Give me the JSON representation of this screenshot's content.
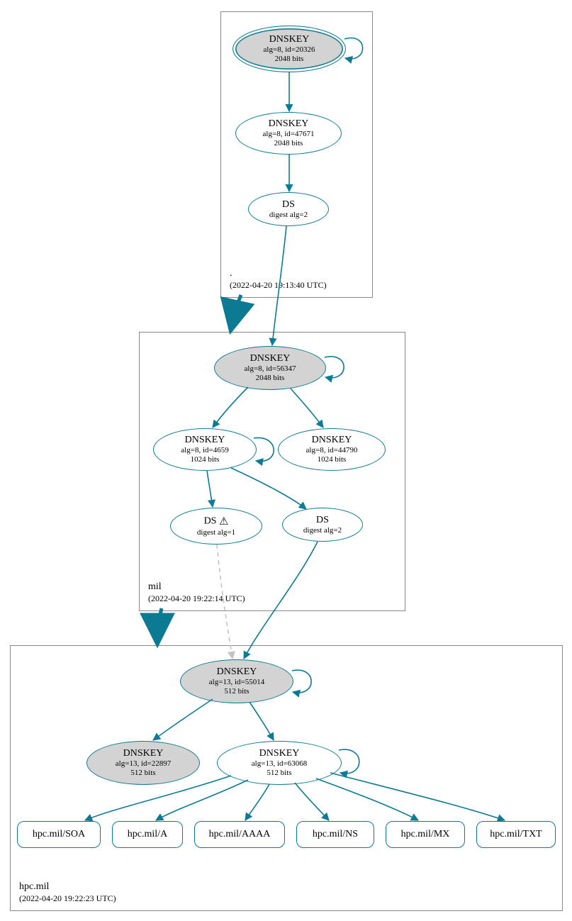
{
  "zones": {
    "root": {
      "name": ".",
      "timestamp": "(2022-04-20 19:13:40 UTC)"
    },
    "mil": {
      "name": "mil",
      "timestamp": "(2022-04-20 19:22:14 UTC)"
    },
    "hpc": {
      "name": "hpc.mil",
      "timestamp": "(2022-04-20 19:22:23 UTC)"
    }
  },
  "nodes": {
    "root_ksk": {
      "title": "DNSKEY",
      "line2": "alg=8, id=20326",
      "line3": "2048 bits"
    },
    "root_zsk": {
      "title": "DNSKEY",
      "line2": "alg=8, id=47671",
      "line3": "2048 bits"
    },
    "root_ds": {
      "title": "DS",
      "line2": "digest alg=2"
    },
    "mil_ksk": {
      "title": "DNSKEY",
      "line2": "alg=8, id=56347",
      "line3": "2048 bits"
    },
    "mil_zsk1": {
      "title": "DNSKEY",
      "line2": "alg=8, id=4659",
      "line3": "1024 bits"
    },
    "mil_zsk2": {
      "title": "DNSKEY",
      "line2": "alg=8, id=44790",
      "line3": "1024 bits"
    },
    "mil_ds1": {
      "title": "DS",
      "line2": "digest alg=1",
      "warn": "⚠"
    },
    "mil_ds2": {
      "title": "DS",
      "line2": "digest alg=2"
    },
    "hpc_ksk": {
      "title": "DNSKEY",
      "line2": "alg=13, id=55014",
      "line3": "512 bits"
    },
    "hpc_key2": {
      "title": "DNSKEY",
      "line2": "alg=13, id=22897",
      "line3": "512 bits"
    },
    "hpc_zsk": {
      "title": "DNSKEY",
      "line2": "alg=13, id=63068",
      "line3": "512 bits"
    },
    "rr_soa": {
      "label": "hpc.mil/SOA"
    },
    "rr_a": {
      "label": "hpc.mil/A"
    },
    "rr_aaaa": {
      "label": "hpc.mil/AAAA"
    },
    "rr_ns": {
      "label": "hpc.mil/NS"
    },
    "rr_mx": {
      "label": "hpc.mil/MX"
    },
    "rr_txt": {
      "label": "hpc.mil/TXT"
    }
  }
}
